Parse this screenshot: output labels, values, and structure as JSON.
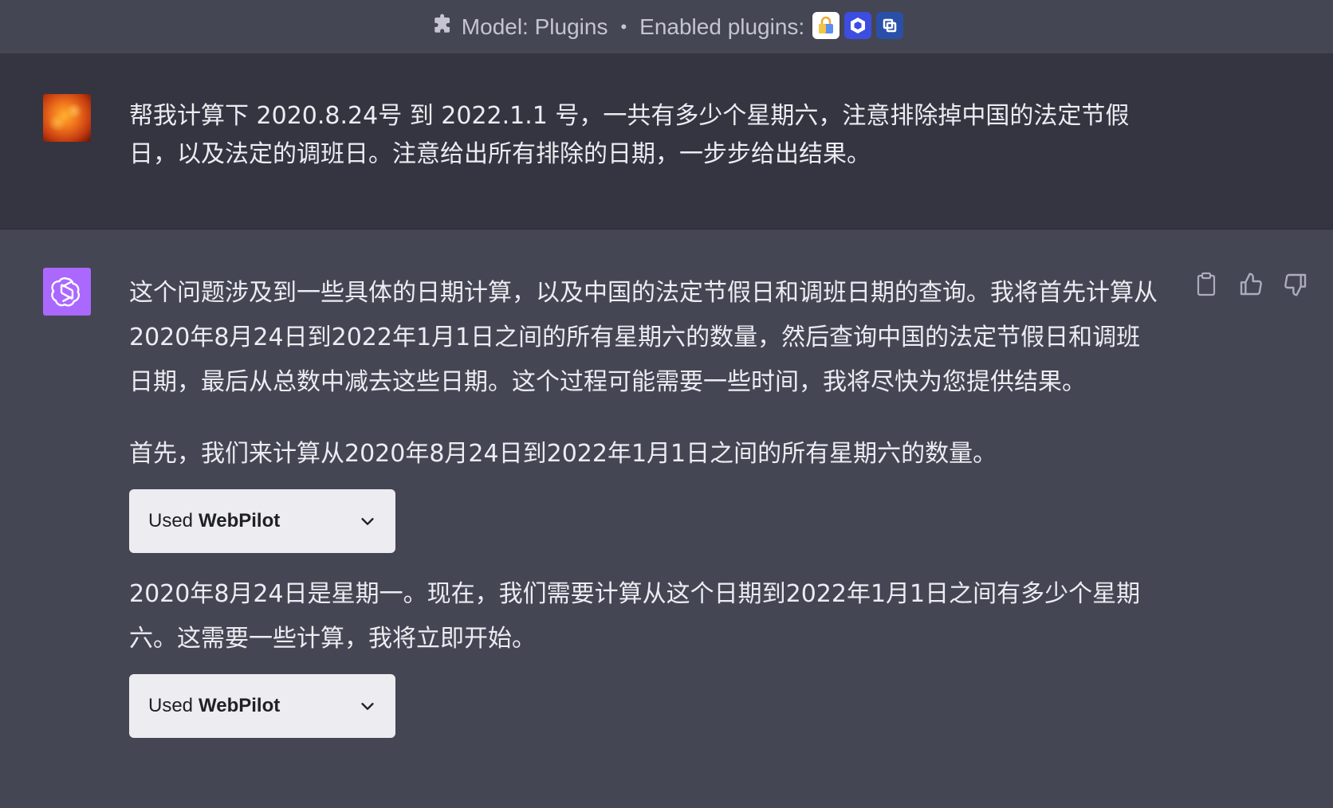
{
  "header": {
    "model_label": "Model: Plugins",
    "separator": "•",
    "enabled_label": "Enabled plugins:",
    "plugins": [
      {
        "icon": "shopping-bag-plugin-icon",
        "color": "#ffffff"
      },
      {
        "icon": "hexagon-plugin-icon",
        "color": "#3d4de0"
      },
      {
        "icon": "square-link-plugin-icon",
        "color": "#2a4fa8"
      }
    ]
  },
  "user_message": {
    "text": "帮我计算下 2020.8.24号 到 2022.1.1 号，一共有多少个星期六，注意排除掉中国的法定节假日，以及法定的调班日。注意给出所有排除的日期，一步步给出结果。"
  },
  "assistant_message": {
    "paragraph_1": "这个问题涉及到一些具体的日期计算，以及中国的法定节假日和调班日期的查询。我将首先计算从2020年8月24日到2022年1月1日之间的所有星期六的数量，然后查询中国的法定节假日和调班日期，最后从总数中减去这些日期。这个过程可能需要一些时间，我将尽快为您提供结果。",
    "paragraph_2": "首先，我们来计算从2020年8月24日到2022年1月1日之间的所有星期六的数量。",
    "tool_use_1": {
      "prefix": "Used",
      "plugin": "WebPilot"
    },
    "paragraph_3": "2020年8月24日是星期一。现在，我们需要计算从这个日期到2022年1月1日之间有多少个星期六。这需要一些计算，我将立即开始。",
    "tool_use_2": {
      "prefix": "Used",
      "plugin": "WebPilot"
    }
  },
  "colors": {
    "assistant_bg": "#444654",
    "user_bg": "#343541",
    "gpt_avatar": "#ab68ff",
    "pill_bg": "#ececf1"
  },
  "icons": [
    "puzzle-icon",
    "openai-logo-icon",
    "copy-icon",
    "thumbs-up-icon",
    "thumbs-down-icon",
    "chevron-down-icon"
  ]
}
